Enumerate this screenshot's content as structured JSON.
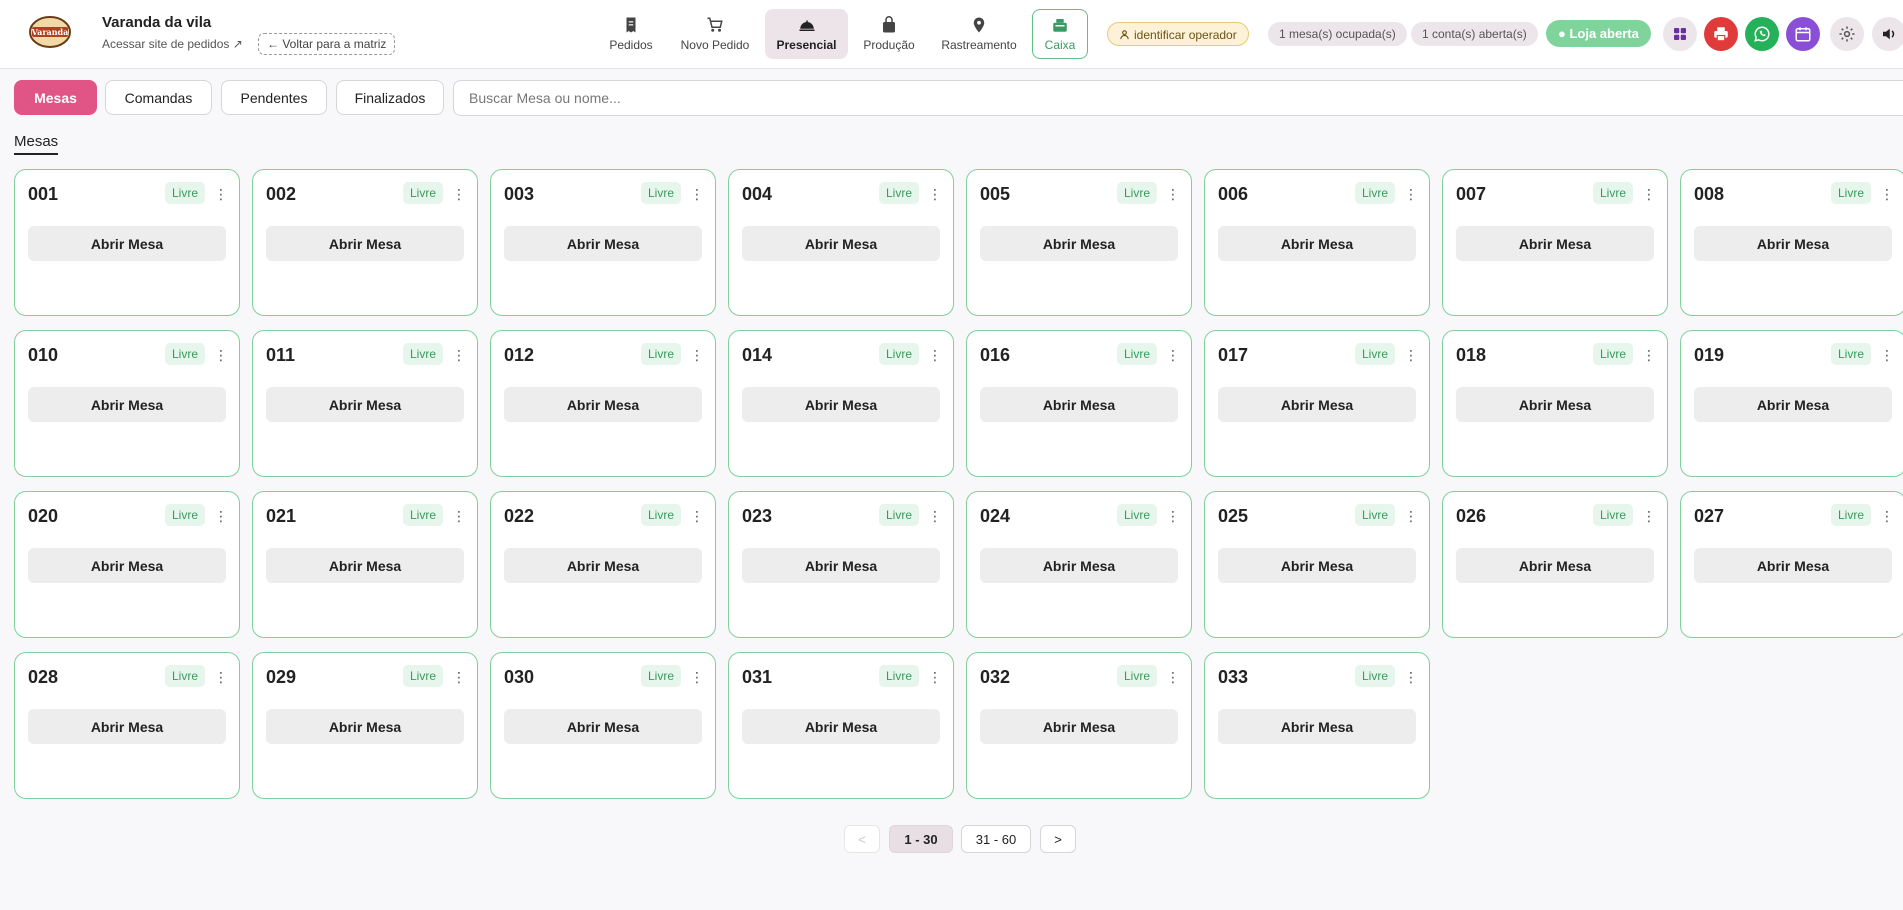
{
  "header": {
    "logo_text": "Varanda",
    "store_name": "Varanda da vila",
    "store_link": "Acessar site de pedidos ↗",
    "back_label": "← Voltar para a matriz"
  },
  "nav": [
    {
      "label": "Pedidos",
      "icon": "receipt-icon"
    },
    {
      "label": "Novo Pedido",
      "icon": "cart-icon"
    },
    {
      "label": "Presencial",
      "icon": "cloche-icon",
      "active": true
    },
    {
      "label": "Produção",
      "icon": "bag-icon"
    },
    {
      "label": "Rastreamento",
      "icon": "location-pin-icon"
    },
    {
      "label": "Caixa",
      "icon": "cash-register-icon"
    }
  ],
  "status": {
    "operator": "identificar operador",
    "tables_occupied": "1 mesa(s) ocupada(s)",
    "accounts_open": "1 conta(s) aberta(s)",
    "store_open": "● Loja aberta"
  },
  "tabs": [
    {
      "label": "Mesas",
      "active": true
    },
    {
      "label": "Comandas"
    },
    {
      "label": "Pendentes"
    },
    {
      "label": "Finalizados"
    }
  ],
  "search": {
    "placeholder": "Buscar Mesa ou nome..."
  },
  "section_title": "Mesas",
  "tables": [
    {
      "number": "001",
      "status": "Livre",
      "action": "Abrir Mesa"
    },
    {
      "number": "002",
      "status": "Livre",
      "action": "Abrir Mesa"
    },
    {
      "number": "003",
      "status": "Livre",
      "action": "Abrir Mesa"
    },
    {
      "number": "004",
      "status": "Livre",
      "action": "Abrir Mesa"
    },
    {
      "number": "005",
      "status": "Livre",
      "action": "Abrir Mesa"
    },
    {
      "number": "006",
      "status": "Livre",
      "action": "Abrir Mesa"
    },
    {
      "number": "007",
      "status": "Livre",
      "action": "Abrir Mesa"
    },
    {
      "number": "008",
      "status": "Livre",
      "action": "Abrir Mesa"
    },
    {
      "number": "010",
      "status": "Livre",
      "action": "Abrir Mesa"
    },
    {
      "number": "011",
      "status": "Livre",
      "action": "Abrir Mesa"
    },
    {
      "number": "012",
      "status": "Livre",
      "action": "Abrir Mesa"
    },
    {
      "number": "014",
      "status": "Livre",
      "action": "Abrir Mesa"
    },
    {
      "number": "016",
      "status": "Livre",
      "action": "Abrir Mesa"
    },
    {
      "number": "017",
      "status": "Livre",
      "action": "Abrir Mesa"
    },
    {
      "number": "018",
      "status": "Livre",
      "action": "Abrir Mesa"
    },
    {
      "number": "019",
      "status": "Livre",
      "action": "Abrir Mesa"
    },
    {
      "number": "020",
      "status": "Livre",
      "action": "Abrir Mesa"
    },
    {
      "number": "021",
      "status": "Livre",
      "action": "Abrir Mesa"
    },
    {
      "number": "022",
      "status": "Livre",
      "action": "Abrir Mesa"
    },
    {
      "number": "023",
      "status": "Livre",
      "action": "Abrir Mesa"
    },
    {
      "number": "024",
      "status": "Livre",
      "action": "Abrir Mesa"
    },
    {
      "number": "025",
      "status": "Livre",
      "action": "Abrir Mesa"
    },
    {
      "number": "026",
      "status": "Livre",
      "action": "Abrir Mesa"
    },
    {
      "number": "027",
      "status": "Livre",
      "action": "Abrir Mesa"
    },
    {
      "number": "028",
      "status": "Livre",
      "action": "Abrir Mesa"
    },
    {
      "number": "029",
      "status": "Livre",
      "action": "Abrir Mesa"
    },
    {
      "number": "030",
      "status": "Livre",
      "action": "Abrir Mesa"
    },
    {
      "number": "031",
      "status": "Livre",
      "action": "Abrir Mesa"
    },
    {
      "number": "032",
      "status": "Livre",
      "action": "Abrir Mesa"
    },
    {
      "number": "033",
      "status": "Livre",
      "action": "Abrir Mesa"
    }
  ],
  "pagination": {
    "prev": "<",
    "pages": [
      "1 - 30",
      "31 - 60"
    ],
    "current": "1 - 30",
    "next": ">"
  },
  "colors": {
    "primary": "#e05585",
    "free_border": "#7fd09a",
    "store_open": "#7fd49c",
    "icon_apps": "#6b2fa0",
    "icon_print": "#e03a3a",
    "icon_whatsapp": "#25b15a",
    "icon_calendar": "#8a4fd6"
  },
  "icons": [
    "apps-grid-icon",
    "printer-icon",
    "whatsapp-icon",
    "calendar-icon",
    "gear-icon",
    "speaker-icon"
  ]
}
